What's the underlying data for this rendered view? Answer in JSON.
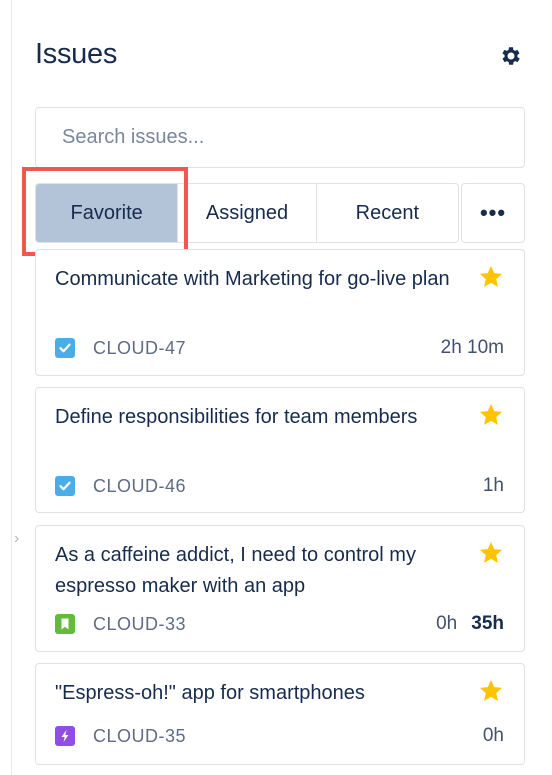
{
  "header": {
    "title": "Issues",
    "settings_icon": "gear-icon"
  },
  "search": {
    "placeholder": "Search issues...",
    "value": ""
  },
  "tabs": [
    {
      "label": "Favorite",
      "active": true
    },
    {
      "label": "Assigned",
      "active": false
    },
    {
      "label": "Recent",
      "active": false
    }
  ],
  "more_button": {
    "label": "•••",
    "icon": "more-horizontal-icon"
  },
  "colors": {
    "active_tab": "#b3c4d9",
    "highlight": "#f0584f",
    "star": "#ffc400",
    "task": "#4bade8",
    "story": "#63ba3c",
    "epic": "#904ee2",
    "text": "#172b4d",
    "muted": "#5e6c84"
  },
  "issues": [
    {
      "title": "Communicate with Marketing for go-live plan",
      "type": "task",
      "type_icon": "task-checkbox-icon",
      "key": "CLOUD-47",
      "time": "2h 10m",
      "time_extra": "",
      "starred": true
    },
    {
      "title": "Define responsibilities for team members",
      "type": "task",
      "type_icon": "task-checkbox-icon",
      "key": "CLOUD-46",
      "time": "1h",
      "time_extra": "",
      "starred": true
    },
    {
      "title": "As a caffeine addict, I need to control my espresso maker with an app",
      "type": "story",
      "type_icon": "story-bookmark-icon",
      "key": "CLOUD-33",
      "time": "0h",
      "time_extra": "35h",
      "starred": true
    },
    {
      "title": "\"Espress-oh!\" app for smartphones",
      "type": "epic",
      "type_icon": "epic-lightning-icon",
      "key": "CLOUD-35",
      "time": "0h",
      "time_extra": "",
      "starred": true
    }
  ]
}
